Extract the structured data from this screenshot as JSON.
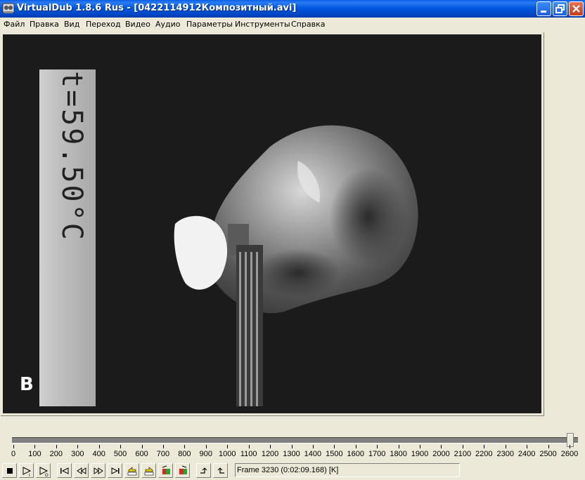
{
  "window": {
    "title": "VirtualDub 1.8.6 Rus - [0422114912Композитный.avi]"
  },
  "menu": [
    "Файл",
    "Правка",
    "Вид",
    "Переход",
    "Видео",
    "Аудио",
    "Параметры",
    "Инструменты",
    "Справка"
  ],
  "video": {
    "panel_label": "B",
    "thermometer_text": "t=59.50°C"
  },
  "timeline": {
    "ticks": [
      "0",
      "100",
      "200",
      "300",
      "400",
      "500",
      "600",
      "700",
      "800",
      "900",
      "1000",
      "1100",
      "1200",
      "1300",
      "1400",
      "1500",
      "1600",
      "1700",
      "1800",
      "1900",
      "2000",
      "2100",
      "2200",
      "2300",
      "2400",
      "2500",
      "2600"
    ],
    "position_fraction": 1.0
  },
  "toolbar": {
    "buttons": [
      "stop-icon",
      "play-input-icon",
      "play-output-icon",
      "go-start-icon",
      "prev-frame-icon",
      "next-frame-icon",
      "go-end-icon",
      "prev-keyframe-icon",
      "next-keyframe-icon",
      "scene-back-icon",
      "scene-forward-icon",
      "mark-in-icon",
      "mark-out-icon"
    ]
  },
  "status": {
    "frame_text": "Frame 3230 (0:02:09.168) [K]"
  }
}
